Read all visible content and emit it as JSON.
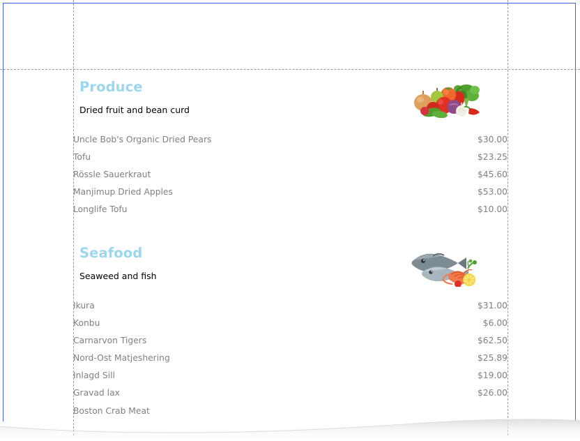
{
  "document": {
    "page_edge_visible": true,
    "colors": {
      "page_border": "#4060e8",
      "guide": "#9a9a9a",
      "heading": "#9BD7EE",
      "body_text": "#000000",
      "list_text": "#808080"
    }
  },
  "sections": [
    {
      "title": "Produce",
      "description": "Dried fruit and bean curd",
      "photo": "vegetables-photo",
      "products": [
        {
          "name": "Uncle Bob's Organic Dried Pears",
          "price": "$30.00"
        },
        {
          "name": "Tofu",
          "price": "$23.25"
        },
        {
          "name": "Rössle Sauerkraut",
          "price": "$45.60"
        },
        {
          "name": "Manjimup Dried Apples",
          "price": "$53.00"
        },
        {
          "name": "Longlife Tofu",
          "price": "$10.00"
        }
      ]
    },
    {
      "title": "Seafood",
      "description": "Seaweed and fish",
      "photo": "fish-photo",
      "products": [
        {
          "name": "Ikura",
          "price": "$31.00"
        },
        {
          "name": "Konbu",
          "price": "$6.00"
        },
        {
          "name": "Carnarvon Tigers",
          "price": "$62.50"
        },
        {
          "name": "Nord-Ost Matjeshering",
          "price": "$25.89"
        },
        {
          "name": "Inlagd Sill",
          "price": "$19.00"
        },
        {
          "name": "Gravad lax",
          "price": "$26.00"
        },
        {
          "name": "Boston Crab Meat",
          "price": ""
        }
      ]
    }
  ]
}
